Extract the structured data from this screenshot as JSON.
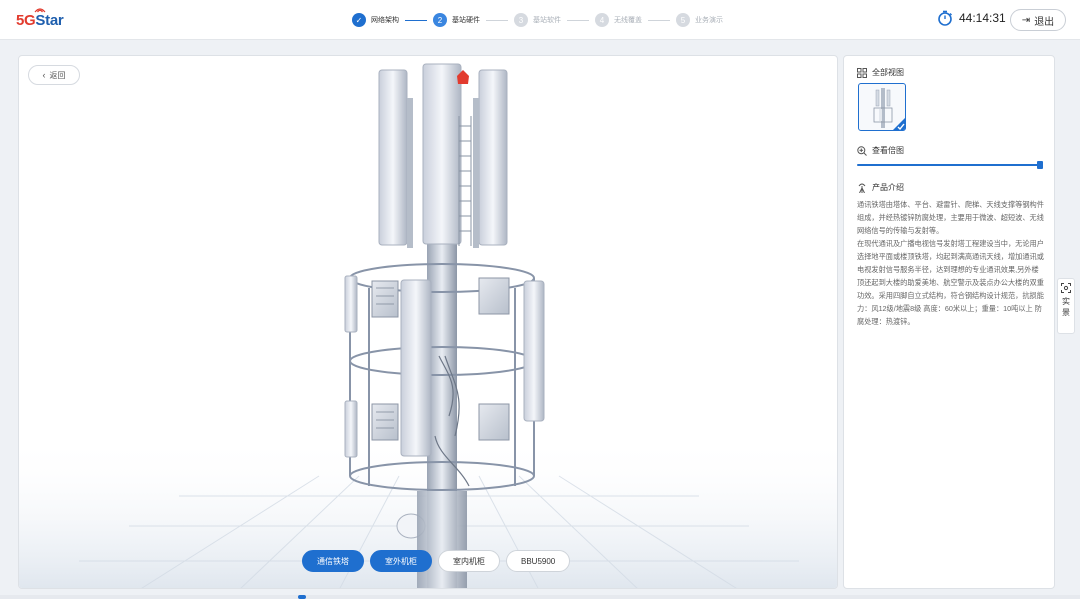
{
  "header": {
    "logo_text_a": "5G",
    "logo_text_b": "Star",
    "steps": [
      {
        "num": "✓",
        "label": "网络架构",
        "state": "done"
      },
      {
        "num": "2",
        "label": "基站硬件",
        "state": "active"
      },
      {
        "num": "3",
        "label": "基站软件",
        "state": "todo"
      },
      {
        "num": "4",
        "label": "无线覆盖",
        "state": "todo"
      },
      {
        "num": "5",
        "label": "业务演示",
        "state": "todo"
      }
    ],
    "timer": "44:14:31",
    "exit_label": "退出",
    "exit_icon": "logout-icon",
    "timer_icon": "stopwatch-icon"
  },
  "viewer": {
    "back_label": "返回",
    "buttons": [
      {
        "label": "通信铁塔",
        "style": "primary"
      },
      {
        "label": "室外机柜",
        "style": "primary"
      },
      {
        "label": "室内机柜",
        "style": "outline"
      },
      {
        "label": "BBU5900",
        "style": "outline"
      }
    ]
  },
  "panel": {
    "all_views_title": "全部视图",
    "zoom_title": "查看倍图",
    "zoom_level": 1.0,
    "intro_title": "产品介绍",
    "intro_paragraphs": [
      "通讯铁塔由塔体、平台、避雷针、爬梯、天线支撑等钢构件组成，并经热镀锌防腐处理，主要用于微波、超短波、无线网络信号的传输与发射等。",
      "在现代通讯及广播电视信号发射塔工程建设当中，无论用户选择地平面或楼顶铁塔，均起到满高通讯天线，增加通讯或电视发射信号服务半径，达到理想的专业通讯效果,另外楼顶还起到大楼的助爱美地、航空警示及装点办公大楼的双重功效。采用四脚自立式结构，符合钢结构设计规范，抗损能力：风12级/地震8级 高度：60米以上；重量：10吨以上 防腐处理：热渡锌。"
    ]
  },
  "side_tab": {
    "label": "实景",
    "icon": "scan-icon"
  },
  "colors": {
    "accent": "#1f6fcf",
    "brand_red": "#e23b2e",
    "brand_blue": "#1f5fae"
  }
}
